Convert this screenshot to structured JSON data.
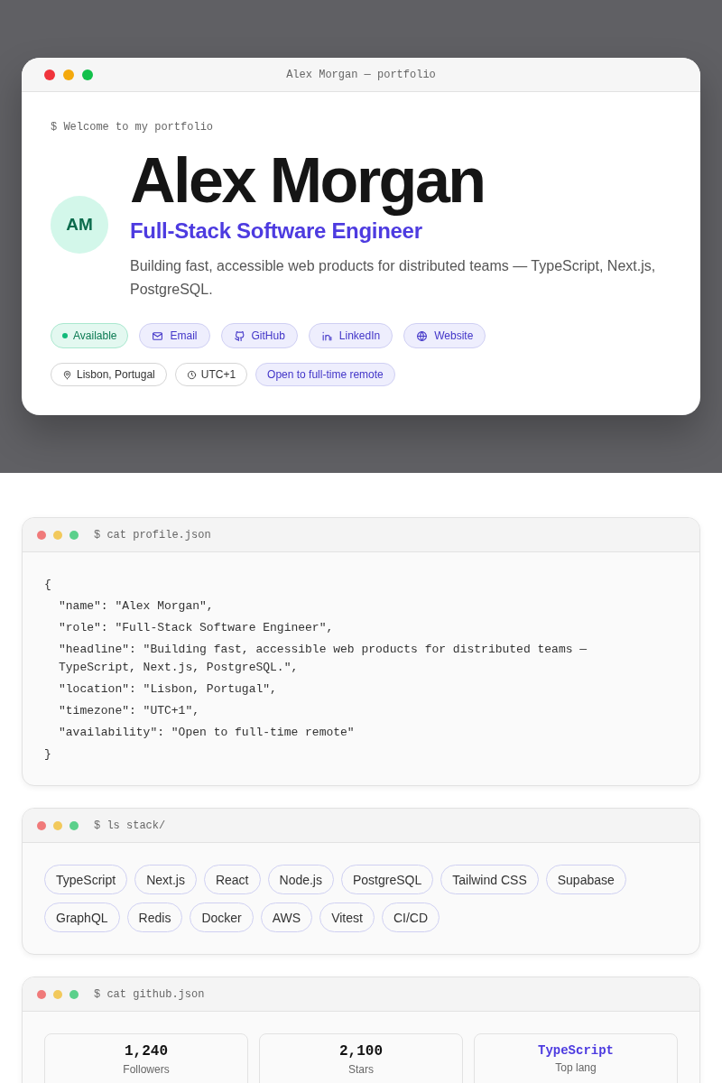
{
  "hero": {
    "window_title": "Alex Morgan — portfolio",
    "prompt": "$ Welcome to my portfolio",
    "avatar": "AM",
    "name": "Alex Morgan",
    "role": "Full-Stack Software Engineer",
    "headline": "Building fast, accessible web products for distributed teams — TypeScript, Next.js, PostgreSQL.",
    "links": [
      {
        "kind": "status",
        "label": "Available"
      },
      {
        "kind": "email",
        "label": "Email"
      },
      {
        "kind": "github",
        "label": "GitHub"
      },
      {
        "kind": "linkedin",
        "label": "LinkedIn"
      },
      {
        "kind": "website",
        "label": "Website"
      }
    ],
    "meta": [
      {
        "kind": "location",
        "label": "Lisbon, Portugal"
      },
      {
        "kind": "timezone",
        "label": "UTC+1"
      },
      {
        "kind": "highlight",
        "label": "Open to full-time remote"
      }
    ]
  },
  "profile": {
    "command": "$ cat profile.json",
    "open": "{",
    "lines": [
      "\"name\": \"Alex Morgan\",",
      "\"role\": \"Full-Stack Software Engineer\",",
      "\"headline\": \"Building fast, accessible web products for distributed teams — TypeScript, Next.js, PostgreSQL.\",",
      "\"location\": \"Lisbon, Portugal\",",
      "\"timezone\": \"UTC+1\",",
      "\"availability\": \"Open to full-time remote\""
    ],
    "close": "}"
  },
  "stack": {
    "command": "$ ls stack/",
    "items": [
      "TypeScript",
      "Next.js",
      "React",
      "Node.js",
      "PostgreSQL",
      "Tailwind CSS",
      "Supabase",
      "GraphQL",
      "Redis",
      "Docker",
      "AWS",
      "Vitest",
      "CI/CD"
    ]
  },
  "github": {
    "command": "$ cat github.json",
    "stats": [
      {
        "kind": "number",
        "value": "1,240",
        "label": "Followers"
      },
      {
        "kind": "number",
        "value": "2,100",
        "label": "Stars"
      },
      {
        "kind": "lang",
        "value": "TypeScript",
        "label": "Top lang"
      }
    ]
  }
}
